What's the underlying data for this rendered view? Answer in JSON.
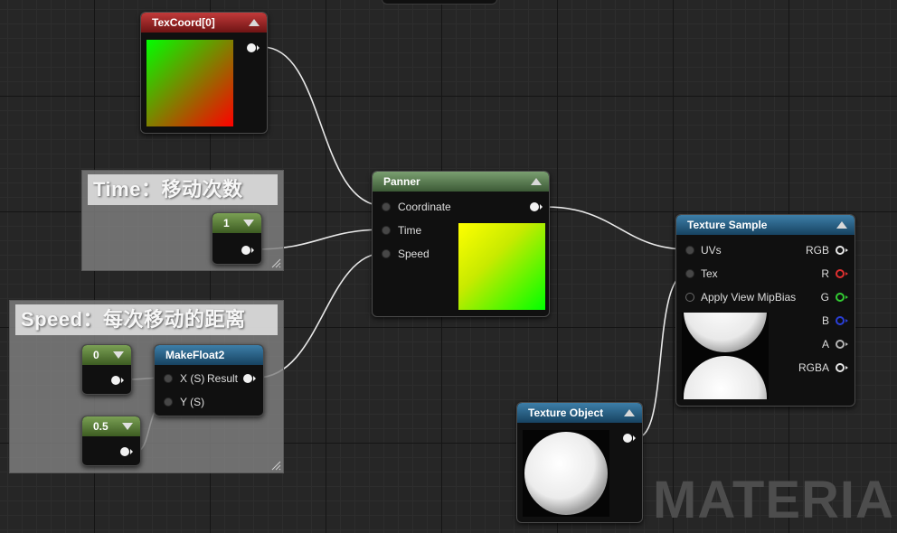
{
  "comments": {
    "time": {
      "title": "Time：移动次数"
    },
    "speed": {
      "title": "Speed：每次移动的距离"
    }
  },
  "nodes": {
    "texcoord": {
      "title": "TexCoord[0]"
    },
    "panner": {
      "title": "Panner",
      "inputs": [
        "Coordinate",
        "Time",
        "Speed"
      ]
    },
    "texture_sample": {
      "title": "Texture Sample",
      "inputs": [
        "UVs",
        "Tex",
        "Apply View MipBias"
      ],
      "outputs": [
        "RGB",
        "R",
        "G",
        "B",
        "A",
        "RGBA"
      ]
    },
    "texture_object": {
      "title": "Texture Object"
    },
    "make_float2": {
      "title": "MakeFloat2",
      "inputs": [
        "X (S)",
        "Y (S)"
      ],
      "output": "Result"
    },
    "const_time": {
      "value": "1"
    },
    "const_x": {
      "value": "0"
    },
    "const_y": {
      "value": "0.5"
    }
  },
  "colors": {
    "pin_r": "#e03030",
    "pin_g": "#33cc33",
    "pin_b": "#2a3fd8",
    "texcoord_header": "#a02828",
    "panner_header": "#5a7d52",
    "texture_header": "#2a6285",
    "const_header": "#5b7e3a"
  },
  "watermark": "MATERIAL"
}
